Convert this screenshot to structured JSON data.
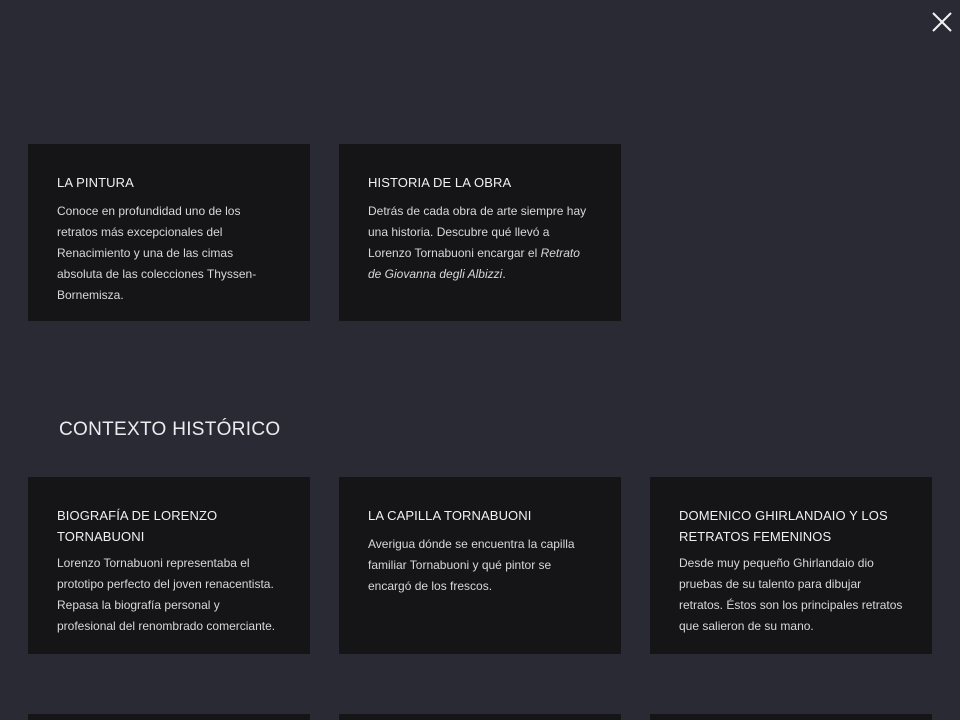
{
  "close": {
    "icon": "close-icon"
  },
  "top_cards": [
    {
      "title": "LA PINTURA",
      "body": "Conoce en profundidad uno de los retratos más excepcionales del Renacimiento y una de las cimas absoluta de las colecciones Thyssen-Bornemisza."
    },
    {
      "title": "HISTORIA DE LA OBRA",
      "body_pre": "Detrás de cada obra de arte siempre hay una historia. Descubre qué llevó a Lorenzo Tornabuoni encargar el ",
      "body_italic": "Retrato de Giovanna degli Albizzi",
      "body_post": "."
    }
  ],
  "section": {
    "heading": "CONTEXTO HISTÓRICO"
  },
  "context_cards": [
    {
      "title": "BIOGRAFÍA DE LORENZO TORNABUONI",
      "body": "Lorenzo Tornabuoni representaba el prototipo perfecto del joven renacentista. Repasa la biografía personal y profesional del renombrado comerciante."
    },
    {
      "title": "LA CAPILLA TORNABUONI",
      "body": "Averigua dónde se encuentra la capilla familiar Tornabuoni y qué pintor se encargó de los frescos."
    },
    {
      "title": "DOMENICO GHIRLANDAIO Y LOS RETRATOS FEMENINOS",
      "body": "Desde muy pequeño Ghirlandaio dio pruebas de su talento para dibujar retratos. Éstos son los principales retratos que salieron de su mano."
    }
  ]
}
